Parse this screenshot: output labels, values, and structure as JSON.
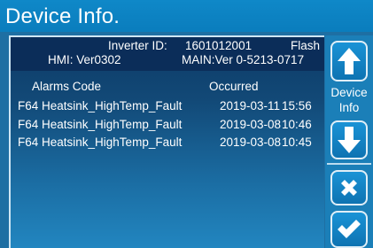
{
  "title": "Device Info.",
  "header": {
    "inverter_id_label": "Inverter ID:",
    "inverter_id": "1601012001",
    "flash": "Flash",
    "hmi": "HMI: Ver0302",
    "main_version": "MAIN:Ver 0-5213-0717"
  },
  "table": {
    "columns": [
      "Alarms Code",
      "Occurred"
    ],
    "rows": [
      {
        "code": "F64 Heatsink_HighTemp_Fault",
        "date": "2019-03-11",
        "time": "15:56"
      },
      {
        "code": "F64 Heatsink_HighTemp_Fault",
        "date": "2019-03-08",
        "time": "10:46"
      },
      {
        "code": "F64 Heatsink_HighTemp_Fault",
        "date": "2019-03-08",
        "time": "10:45"
      }
    ]
  },
  "side": {
    "up_icon": "arrow-up-icon",
    "label_line1": "Device",
    "label_line2": "Info",
    "down_icon": "arrow-down-icon",
    "cancel_icon": "x-icon",
    "confirm_icon": "check-icon"
  },
  "colors": {
    "title_bar": "#0a7dbd",
    "header_bg": "#0b2d59",
    "button_bg": "#1283c5",
    "text": "#ffffff"
  }
}
